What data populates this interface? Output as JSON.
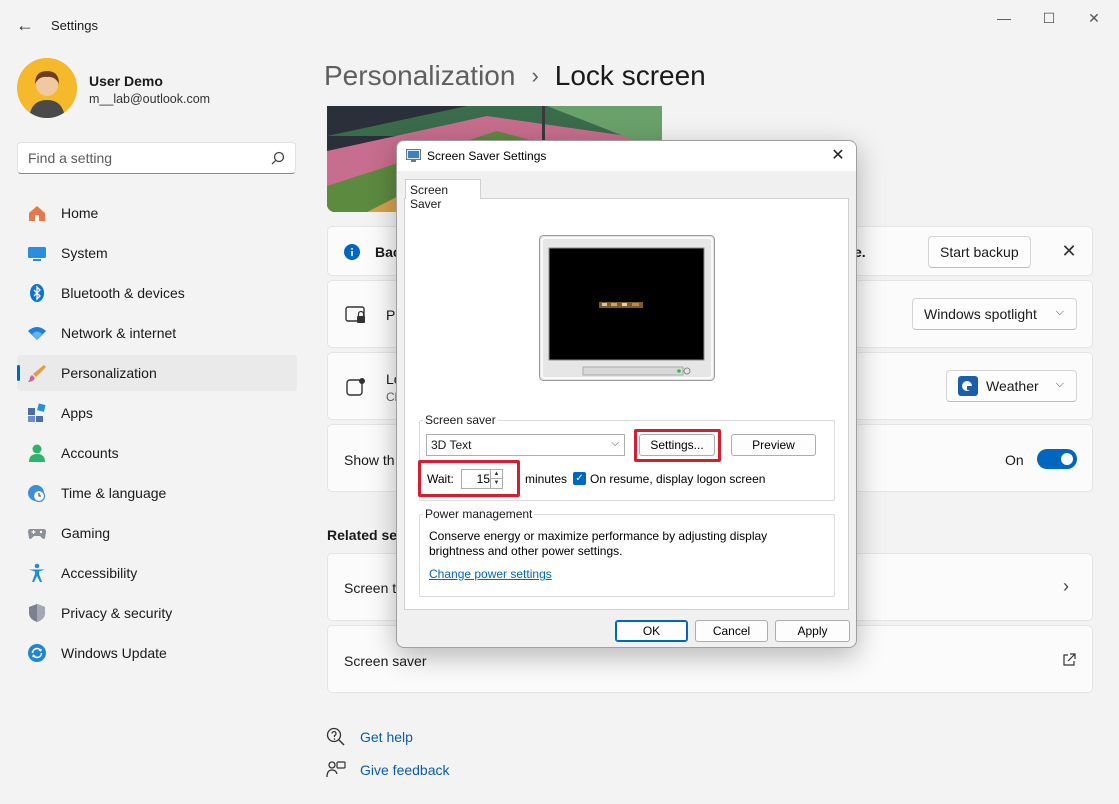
{
  "window": {
    "title": "Settings"
  },
  "user": {
    "name": "User Demo",
    "email": "m__lab@outlook.com"
  },
  "search": {
    "placeholder": "Find a setting"
  },
  "nav": [
    {
      "label": "Home",
      "icon": "home-icon"
    },
    {
      "label": "System",
      "icon": "system-icon"
    },
    {
      "label": "Bluetooth & devices",
      "icon": "bluetooth-icon"
    },
    {
      "label": "Network & internet",
      "icon": "wifi-icon"
    },
    {
      "label": "Personalization",
      "icon": "brush-icon",
      "active": true
    },
    {
      "label": "Apps",
      "icon": "apps-icon"
    },
    {
      "label": "Accounts",
      "icon": "accounts-icon"
    },
    {
      "label": "Time & language",
      "icon": "clock-globe-icon"
    },
    {
      "label": "Gaming",
      "icon": "gamepad-icon"
    },
    {
      "label": "Accessibility",
      "icon": "accessibility-icon"
    },
    {
      "label": "Privacy & security",
      "icon": "shield-icon"
    },
    {
      "label": "Windows Update",
      "icon": "update-icon"
    }
  ],
  "breadcrumb": {
    "parent": "Personalization",
    "separator": "›",
    "current": "Lock screen"
  },
  "banner": {
    "text_start": "Bac",
    "text_end": "e.",
    "button": "Start backup"
  },
  "rows": {
    "personalize": {
      "title": "Pe",
      "value": "Windows spotlight"
    },
    "status": {
      "title": "Lo",
      "subtitle": "Cl",
      "value": "Weather"
    },
    "show": {
      "title": "Show th",
      "state": "On"
    }
  },
  "related": {
    "title": "Related set",
    "screen_timeout": "Screen ti",
    "screen_saver": "Screen saver"
  },
  "help": {
    "get_help": "Get help",
    "give_feedback": "Give feedback"
  },
  "dialog": {
    "title": "Screen Saver Settings",
    "tab": "Screen Saver",
    "screensaver_group": "Screen saver",
    "screensaver_value": "3D Text",
    "settings_button": "Settings...",
    "preview_button": "Preview",
    "wait_label": "Wait:",
    "wait_value": "15",
    "minutes_label": "minutes",
    "resume_label": "On resume, display logon screen",
    "power_group": "Power management",
    "power_text": "Conserve energy or maximize performance by adjusting display brightness and other power settings.",
    "power_link": "Change power settings",
    "ok": "OK",
    "cancel": "Cancel",
    "apply": "Apply"
  },
  "colors": {
    "accent": "#0067c0",
    "highlight": "#d3202f"
  }
}
